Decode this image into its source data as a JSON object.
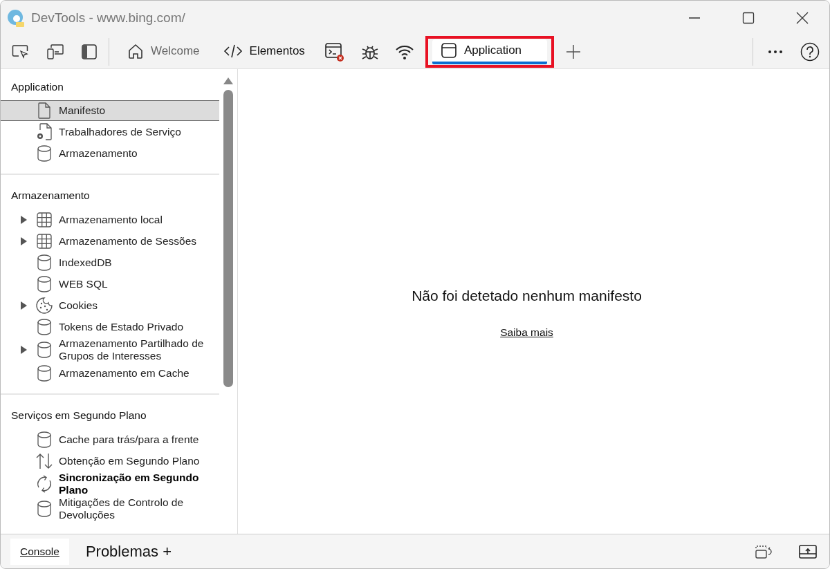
{
  "window": {
    "title": "DevTools - www.bing.com/"
  },
  "tabs": [
    {
      "label": "Welcome",
      "kind": "home",
      "selected": false,
      "highlighted": false
    },
    {
      "label": "Elementos",
      "kind": "code",
      "selected": false,
      "highlighted": false
    },
    {
      "label": "Application",
      "kind": "app",
      "selected": true,
      "highlighted": true
    }
  ],
  "sidebar": {
    "sections": [
      {
        "title": "Application",
        "items": [
          {
            "label": "Manifesto",
            "kind": "file",
            "selected": true
          },
          {
            "label": "Trabalhadores de Serviço",
            "kind": "worker",
            "selected": false
          },
          {
            "label": "Armazenamento",
            "kind": "database",
            "selected": false
          }
        ]
      },
      {
        "title": "Armazenamento",
        "items": [
          {
            "label": "Armazenamento local",
            "kind": "grid",
            "selected": false,
            "expanded": false
          },
          {
            "label": "Armazenamento de Sessões",
            "kind": "grid",
            "selected": false,
            "expanded": false
          },
          {
            "label": "IndexedDB",
            "kind": "database",
            "selected": false
          },
          {
            "label": "WEB SQL",
            "kind": "database",
            "selected": false
          },
          {
            "label": "Cookies",
            "kind": "cookie",
            "selected": false,
            "expanded": false
          },
          {
            "label": "Tokens de Estado Privado",
            "kind": "database",
            "selected": false
          },
          {
            "label": "Armazenamento Partilhado de Grupos de Interesses",
            "kind": "database",
            "selected": false,
            "expanded": false
          },
          {
            "label": "Armazenamento em Cache",
            "kind": "database",
            "selected": false
          }
        ]
      },
      {
        "title": "Serviços em Segundo Plano",
        "items": [
          {
            "label": "Cache para trás/para a frente",
            "kind": "database",
            "selected": false
          },
          {
            "label": "Obtenção em Segundo Plano",
            "kind": "arrows",
            "selected": false
          },
          {
            "label": "Sincronização em Segundo Plano",
            "kind": "sync",
            "selected": false
          },
          {
            "label": "Mitigações de Controlo de Devoluções",
            "kind": "database",
            "selected": false
          }
        ]
      }
    ]
  },
  "main": {
    "message": "Não foi detetado nenhum manifesto",
    "link": "Saiba mais"
  },
  "drawer": {
    "tabs": [
      {
        "label": "Console",
        "selected": true
      },
      {
        "label": "Problemas +",
        "selected": false
      }
    ]
  }
}
